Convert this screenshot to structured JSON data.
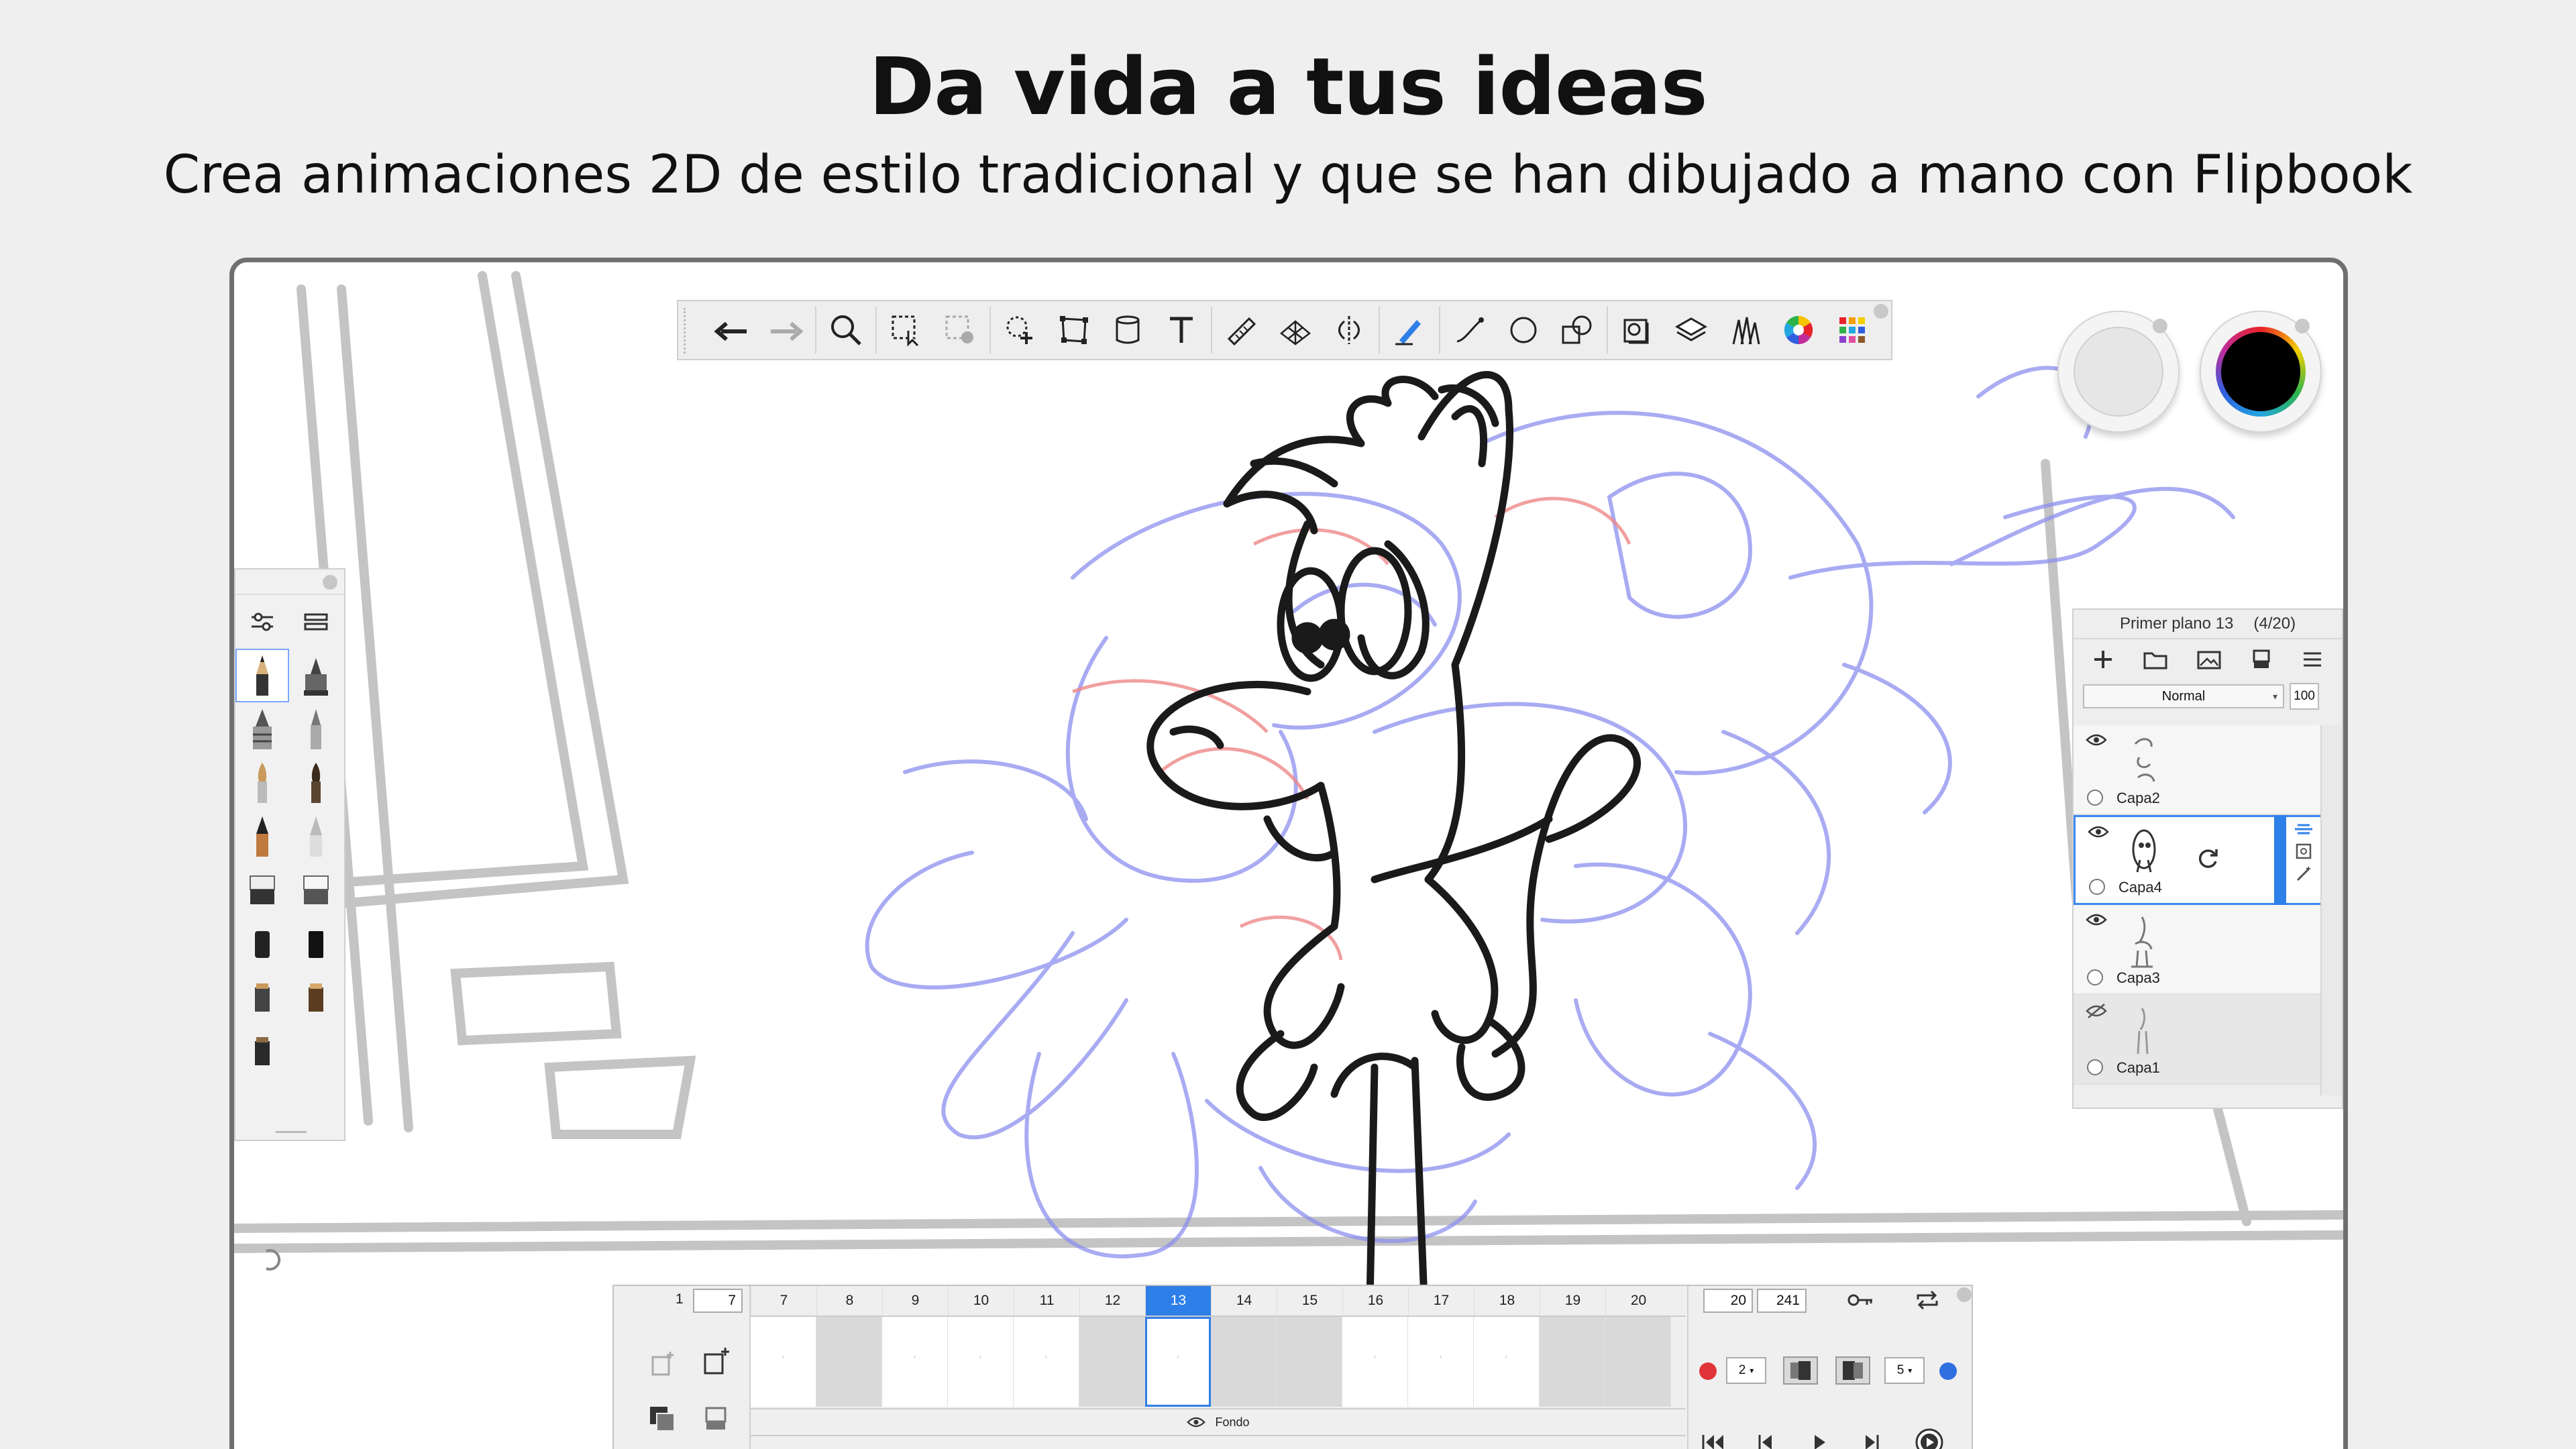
{
  "headline": "Da vida a tus ideas",
  "subline": "Crea animaciones 2D de estilo tradicional y que se han dibujado a mano con Flipbook",
  "toolbar": {
    "tools": [
      "undo-icon",
      "redo-icon",
      "zoom-icon",
      "selection-icon",
      "clear-selection-icon",
      "lasso-transform-icon",
      "distort-transform-icon",
      "bucket-fill-icon",
      "text-icon",
      "ruler-icon",
      "perspective-icon",
      "symmetry-icon",
      "stroke-icon",
      "curve-icon",
      "ellipse-icon",
      "shape-icon",
      "flipbook-icon",
      "layers-icon",
      "brushes-icon",
      "color-wheel-icon",
      "copic-colors-icon"
    ]
  },
  "color_pucks": {
    "secondary": "#e6e6e6",
    "primary": "#000000"
  },
  "brushes": {
    "count": 15,
    "selected_index": 0
  },
  "layers": {
    "title": "Primer plano 13",
    "count": "(4/20)",
    "blend_mode": "Normal",
    "opacity": "100",
    "items": [
      {
        "name": "Capa2",
        "visible": true,
        "active": false
      },
      {
        "name": "Capa4",
        "visible": true,
        "active": true
      },
      {
        "name": "Capa3",
        "visible": true,
        "active": false
      },
      {
        "name": "Capa1",
        "visible": false,
        "active": false
      }
    ]
  },
  "timeline": {
    "start_frame": "1",
    "start_field": "7",
    "frames": [
      "7",
      "8",
      "9",
      "10",
      "11",
      "12",
      "13",
      "14",
      "15",
      "16",
      "17",
      "18",
      "19",
      "20"
    ],
    "current_frame": "13",
    "cell_states": [
      "filled",
      "empty",
      "filled",
      "filled",
      "filled",
      "empty",
      "current",
      "empty",
      "empty",
      "filled",
      "filled",
      "filled",
      "empty",
      "empty"
    ],
    "end_field": "20",
    "total_field": "241",
    "background_layer": "Fondo",
    "range_start": "7",
    "range_end": "20",
    "onion_before": "2",
    "onion_after": "5",
    "onion_before_color": "#e0343a",
    "onion_after_color": "#2f6fe0"
  },
  "colors": {
    "accent": "#2f7fe8",
    "sketch_blue": "#7b7fe8",
    "sketch_red": "#ee7777"
  }
}
